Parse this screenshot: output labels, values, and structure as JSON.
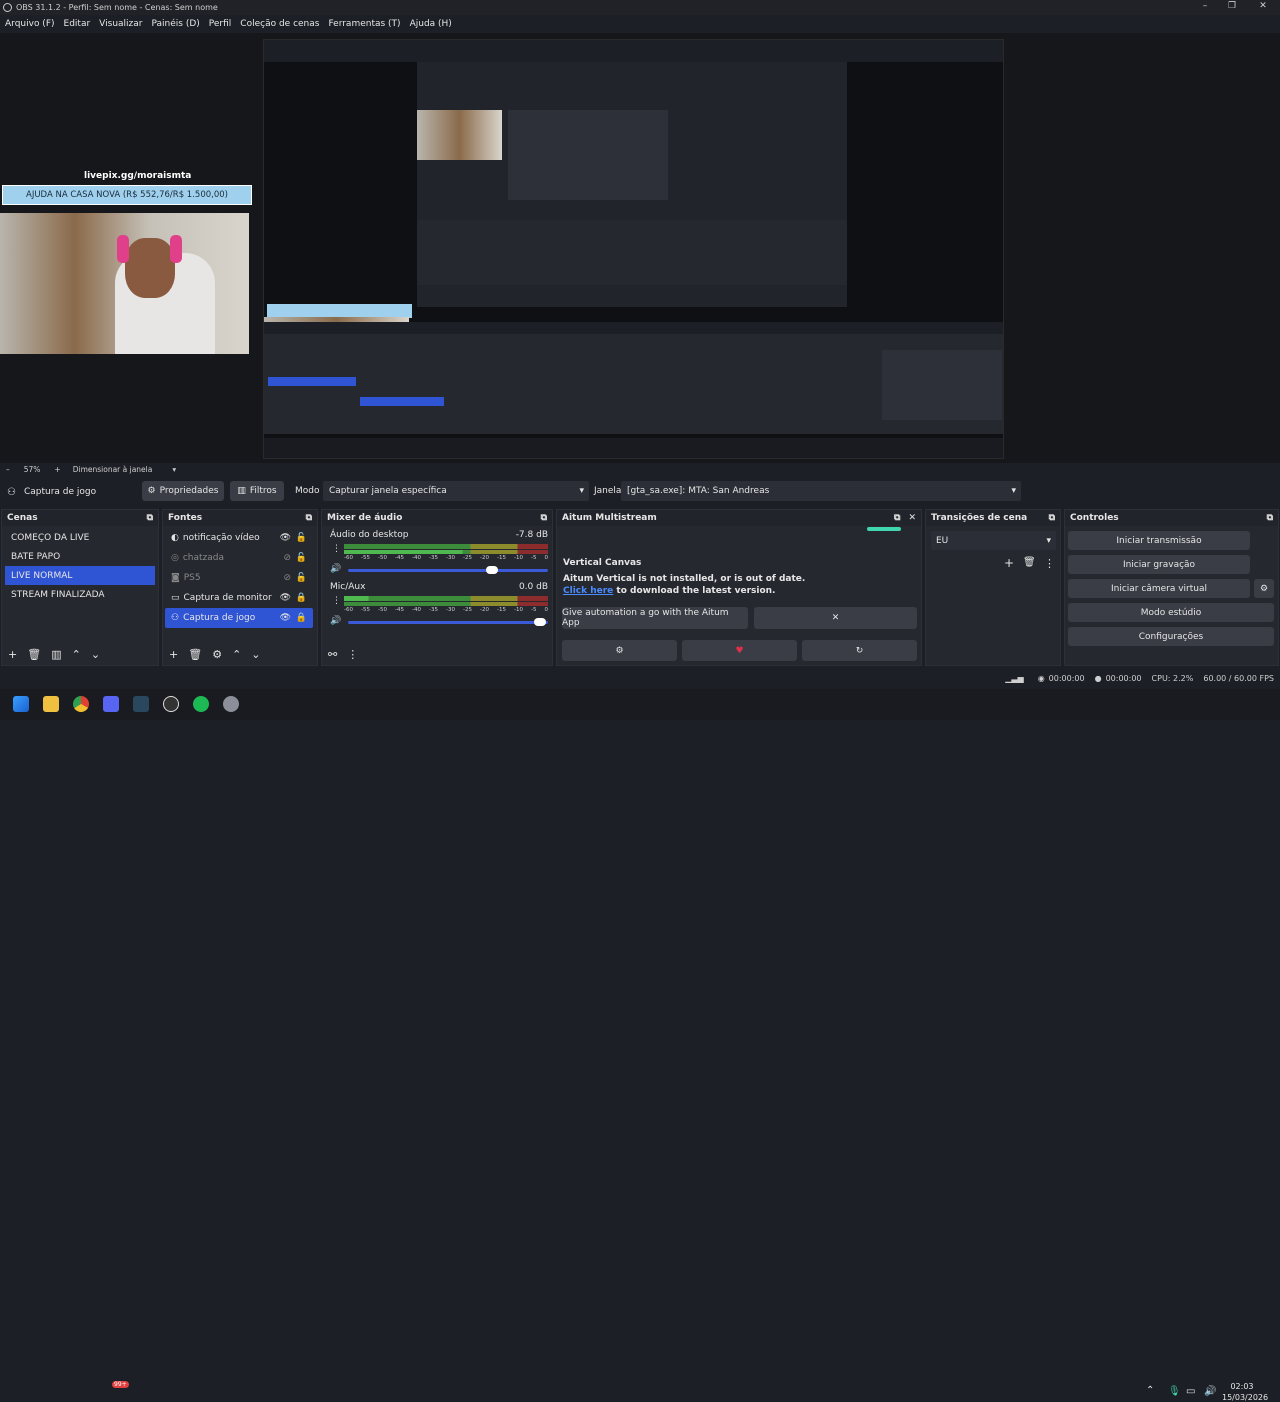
{
  "window": {
    "title": "OBS 31.1.2 - Perfil: Sem nome - Cenas: Sem nome"
  },
  "menu": [
    "Arquivo (F)",
    "Editar",
    "Visualizar",
    "Painéis (D)",
    "Perfil",
    "Coleção de cenas",
    "Ferramentas (T)",
    "Ajuda (H)"
  ],
  "overlay": {
    "url": "livepix.gg/moraismta",
    "goal": "AJUDA NA CASA NOVA (R$ 552,76/R$ 1.500,00)"
  },
  "zoom": {
    "level": "57%",
    "mode": "Dimensionar à janela"
  },
  "source_bar": {
    "source": "Captura de jogo",
    "properties": "Propriedades",
    "filters": "Filtros",
    "mode_label": "Modo",
    "mode_value": "Capturar janela específica",
    "window_label": "Janela",
    "window_value": "[gta_sa.exe]: MTA: San Andreas"
  },
  "scenes": {
    "title": "Cenas",
    "items": [
      "COMEÇO DA LIVE",
      "BATE PAPO",
      "LIVE NORMAL",
      "STREAM FINALIZADA"
    ],
    "selected": 2
  },
  "sources": {
    "title": "Fontes",
    "items": [
      "notificação vídeo",
      "chatzada",
      "PS5",
      "Captura de monitor",
      "Captura de jogo"
    ]
  },
  "mixer": {
    "title": "Mixer de áudio",
    "channels": [
      {
        "name": "Áudio do desktop",
        "db": "-7.8 dB"
      },
      {
        "name": "Mic/Aux",
        "db": "0.0 dB"
      }
    ],
    "ticks": [
      "-60",
      "-55",
      "-50",
      "-45",
      "-40",
      "-35",
      "-30",
      "-25",
      "-20",
      "-15",
      "-10",
      "-5",
      "0"
    ]
  },
  "aitum": {
    "title": "Aitum Multistream",
    "section": "Vertical Canvas",
    "msg1": "Aitum Vertical is not installed, or is out of date.",
    "link": "Click here",
    "msg2": " to download the latest version.",
    "automation": "Give automation a go with the Aitum App"
  },
  "transitions": {
    "title": "Transições de cena",
    "selected": "EU"
  },
  "controls": {
    "title": "Controles",
    "buttons": [
      "Iniciar transmissão",
      "Iniciar gravação",
      "Iniciar câmera virtual",
      "Modo estúdio",
      "Configurações"
    ]
  },
  "status": {
    "rec_time": "00:00:00",
    "stream_time": "00:00:00",
    "cpu": "CPU: 2.2%",
    "fps": "60.00 / 60.00 FPS"
  },
  "clock": {
    "time": "02:03",
    "date": "15/03/2026"
  },
  "taskbar_badge": "99+"
}
